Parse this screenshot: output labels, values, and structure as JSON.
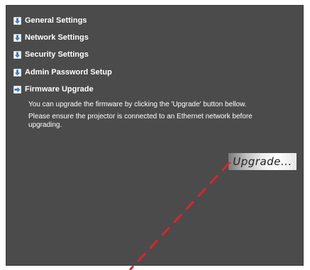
{
  "menu": {
    "items": [
      {
        "label": "General Settings",
        "icon": "down-arrow-icon",
        "expanded": false
      },
      {
        "label": "Network Settings",
        "icon": "down-arrow-icon",
        "expanded": false
      },
      {
        "label": "Security Settings",
        "icon": "down-arrow-icon",
        "expanded": false
      },
      {
        "label": "Admin Password Setup",
        "icon": "down-arrow-icon",
        "expanded": false
      },
      {
        "label": "Firmware Upgrade",
        "icon": "right-arrow-icon",
        "expanded": true
      }
    ]
  },
  "firmware": {
    "instruction": "You can upgrade the firmware by clicking the 'Upgrade' button bellow.",
    "notice": "Please ensure the projector is connected to an Ethernet network before upgrading.",
    "upgrade_button_label": "Upgrade..."
  },
  "colors": {
    "panel_background": "#4b4b4b",
    "text": "#ffffff",
    "icon_arrow": "#3d7fc4",
    "pointer_line": "#d9262a"
  }
}
